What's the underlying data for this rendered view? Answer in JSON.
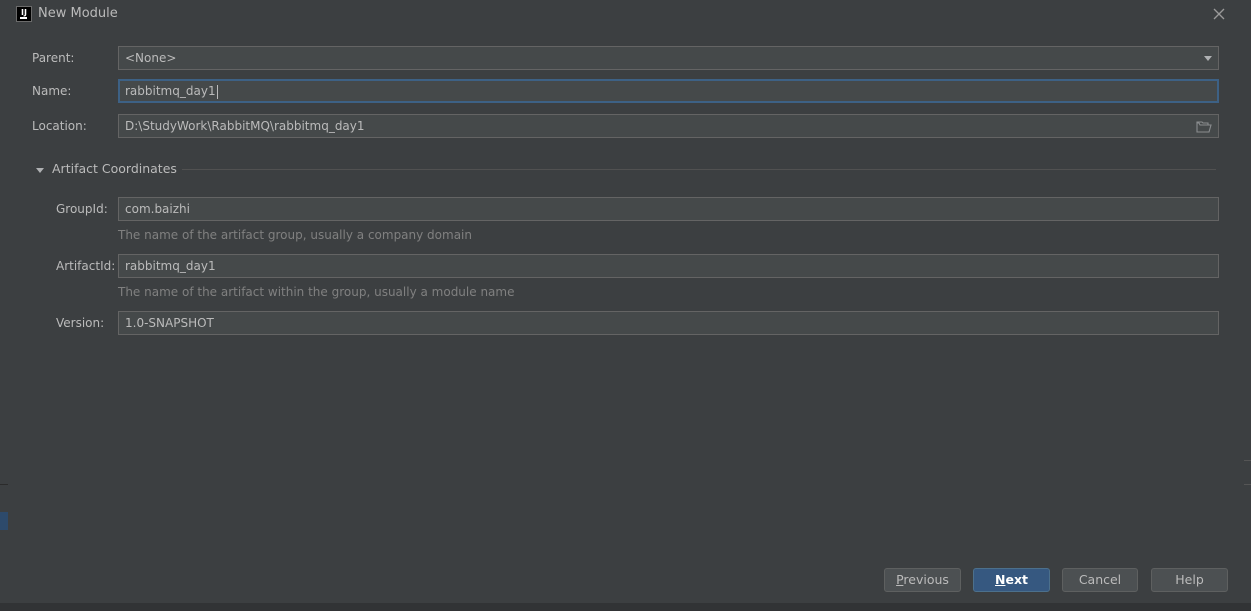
{
  "dialog": {
    "title": "New Module",
    "app_icon_text": "IJ"
  },
  "form": {
    "parent": {
      "label": "Parent:",
      "value": "<None>"
    },
    "name": {
      "label": "Name:",
      "value": "rabbitmq_day1"
    },
    "location": {
      "label": "Location:",
      "value": "D:\\StudyWork\\RabbitMQ\\rabbitmq_day1"
    }
  },
  "artifact_section": {
    "title": "Artifact Coordinates",
    "expanded": true,
    "group_id": {
      "label": "GroupId:",
      "value": "com.baizhi",
      "hint": "The name of the artifact group, usually a company domain"
    },
    "artifact_id": {
      "label": "ArtifactId:",
      "value": "rabbitmq_day1",
      "hint": "The name of the artifact within the group, usually a module name"
    },
    "version": {
      "label": "Version:",
      "value": "1.0-SNAPSHOT"
    }
  },
  "buttons": {
    "previous": {
      "first": "P",
      "rest": "revious"
    },
    "next": {
      "first": "N",
      "rest": "ext"
    },
    "cancel": "Cancel",
    "help": "Help"
  },
  "icons": {
    "close": "close-icon",
    "dropdown": "chevron-down-icon",
    "browse": "folder-icon",
    "section_toggle": "triangle-down-icon"
  },
  "colors": {
    "dialog_bg": "#3c3f41",
    "field_bg": "#45494a",
    "focus_border": "#3d6185",
    "default_button": "#365880",
    "text": "#bbbbbb",
    "hint_text": "#808080"
  }
}
